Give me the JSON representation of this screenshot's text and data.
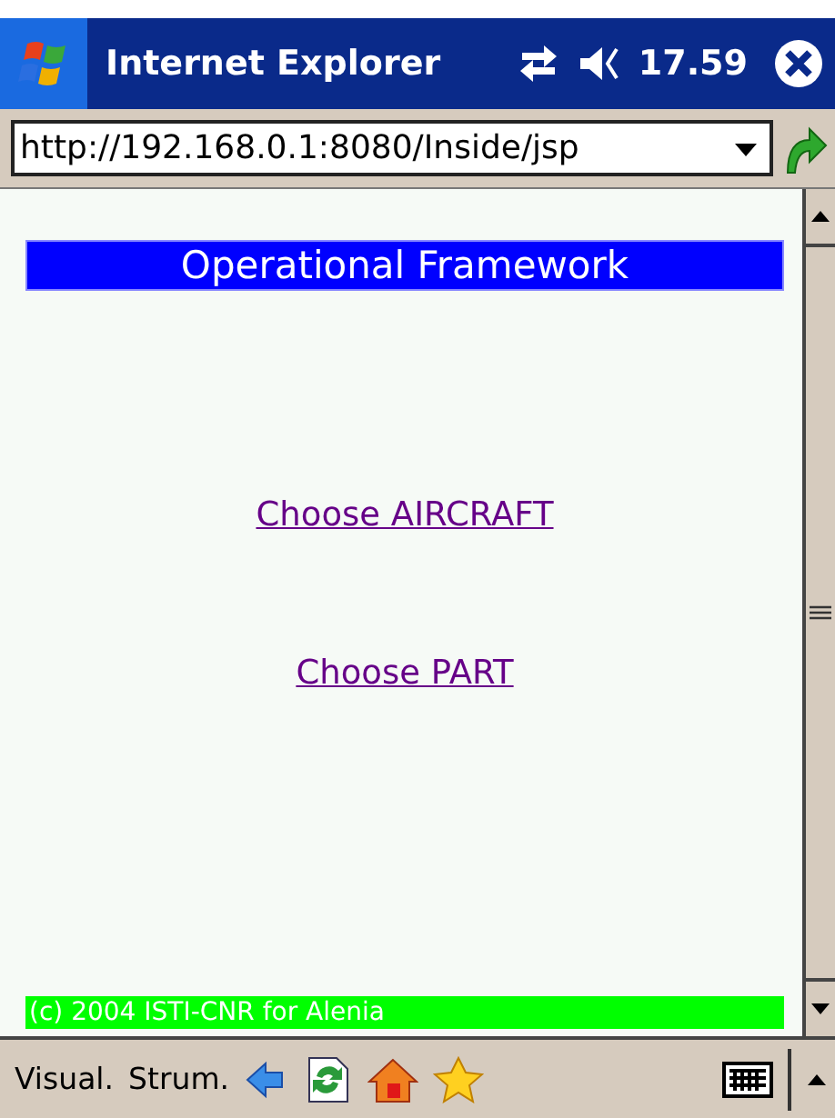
{
  "window": {
    "title": "Internet Explorer",
    "time": "17.59"
  },
  "address_bar": {
    "value": "http://192.168.0.1:8080/Inside/jsp"
  },
  "page": {
    "heading": "Operational Framework",
    "links": [
      "Choose AIRCRAFT",
      "Choose PART"
    ],
    "footer": "(c) 2004 ISTI-CNR for Alenia"
  },
  "menu_bar": {
    "items": [
      "Visual.",
      "Strum."
    ]
  }
}
